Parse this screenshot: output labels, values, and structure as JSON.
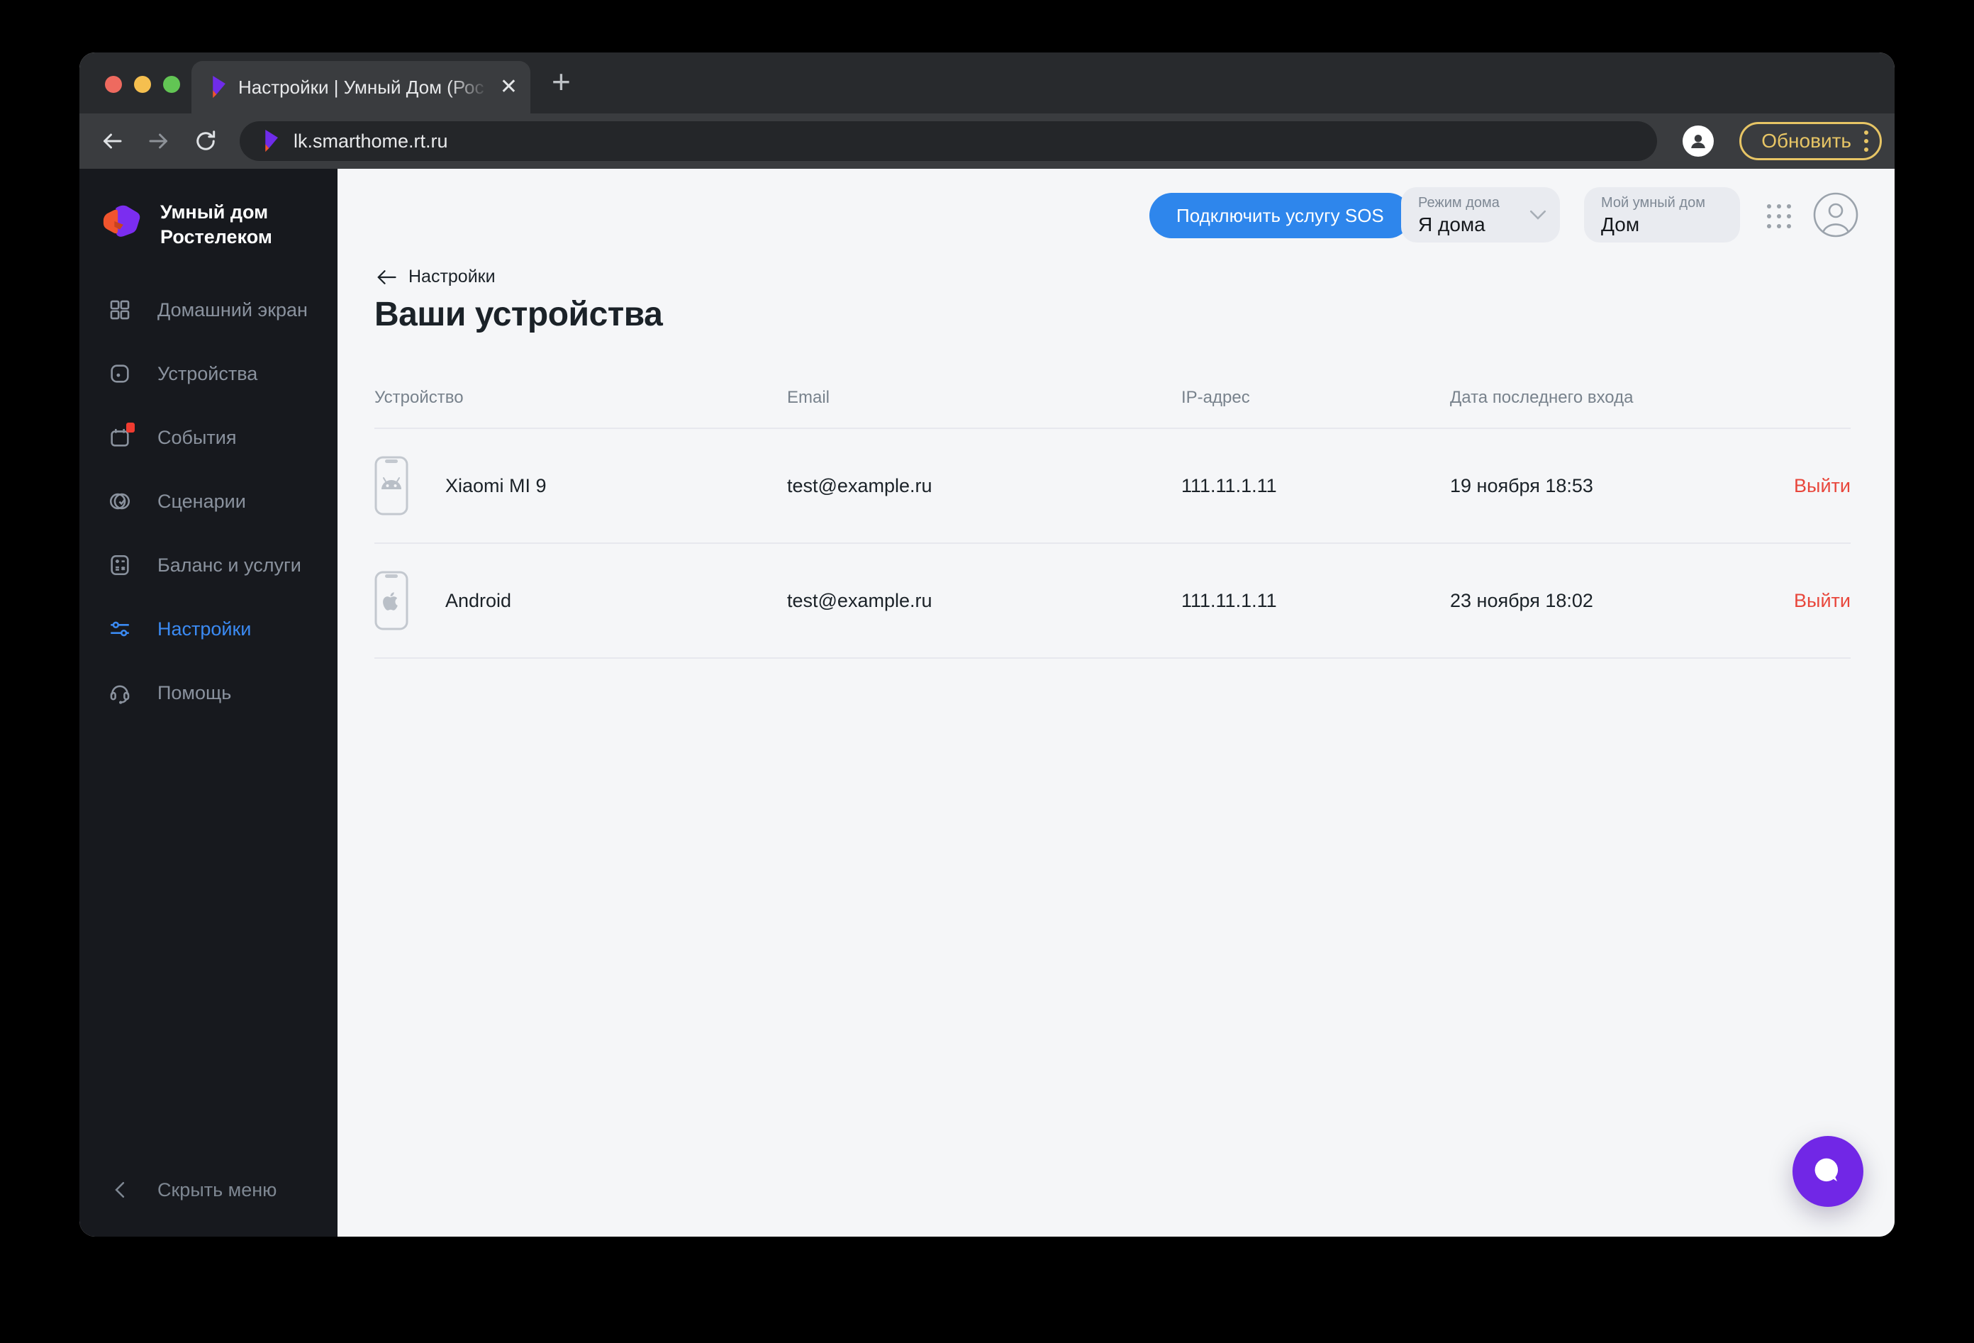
{
  "browser": {
    "tab": {
      "title": "Настройки | Умный Дом (Рос",
      "close_label": "✕",
      "new_tab_label": "+"
    },
    "url": "lk.smarthome.rt.ru",
    "update_button": "Обновить"
  },
  "sidebar": {
    "logo_title_line1": "Умный дом",
    "logo_title_line2": "Ростелеком",
    "items": [
      {
        "label": "Домашний экран",
        "icon": "home-grid-icon",
        "active": false
      },
      {
        "label": "Устройства",
        "icon": "devices-icon",
        "active": false
      },
      {
        "label": "События",
        "icon": "events-calendar-icon",
        "active": false,
        "has_badge": true
      },
      {
        "label": "Сценарии",
        "icon": "scenarios-icon",
        "active": false
      },
      {
        "label": "Баланс и услуги",
        "icon": "balance-icon",
        "active": false
      },
      {
        "label": "Настройки",
        "icon": "settings-sliders-icon",
        "active": true
      },
      {
        "label": "Помощь",
        "icon": "help-headset-icon",
        "active": false
      }
    ],
    "collapse_label": "Скрыть меню"
  },
  "header": {
    "sos_button": "Подключить услугу SOS",
    "mode_pill": {
      "label": "Режим дома",
      "value": "Я дома"
    },
    "home_pill": {
      "label": "Мой умный дом",
      "value": "Дом"
    }
  },
  "page": {
    "breadcrumb": "Настройки",
    "title": "Ваши устройства"
  },
  "devices_table": {
    "columns": [
      "Устройство",
      "Email",
      "IP-адрес",
      "Дата последнего входа"
    ],
    "rows": [
      {
        "device": "Xiaomi MI 9",
        "platform_icon": "android-icon",
        "email": "test@example.ru",
        "ip": "111.11.1.11",
        "last_login": "19 ноября 18:53",
        "action": "Выйти"
      },
      {
        "device": "Android",
        "platform_icon": "apple-icon",
        "email": "test@example.ru",
        "ip": "111.11.1.11",
        "last_login": "23 ноября 18:02",
        "action": "Выйти"
      }
    ]
  },
  "colors": {
    "accent_blue": "#2e86ec",
    "active_link_blue": "#3b8af2",
    "danger_red": "#e8473c",
    "chat_purple": "#7127e6",
    "update_gold": "#e7c565",
    "sidebar_bg": "#17191e",
    "content_bg": "#f5f6f8",
    "browser_chrome": "#3a3c3f"
  }
}
